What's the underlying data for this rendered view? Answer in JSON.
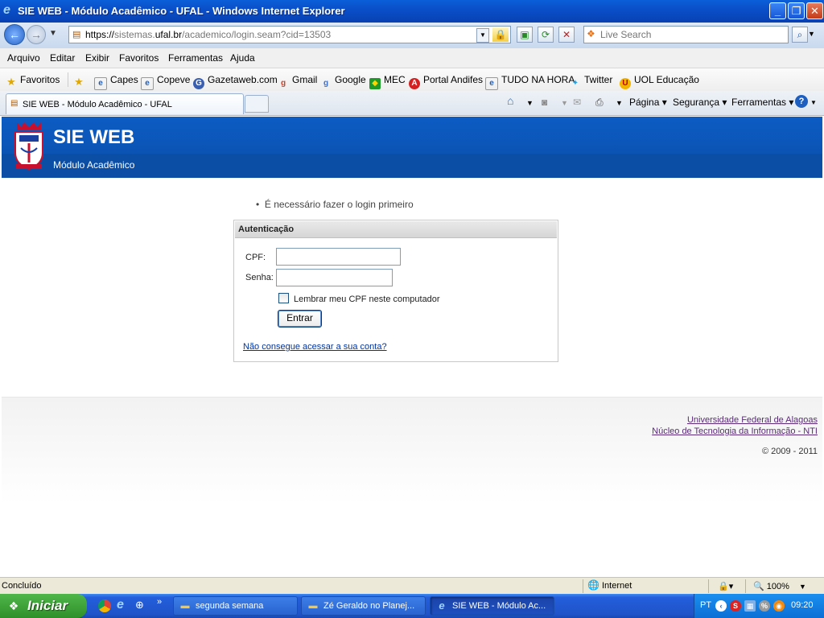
{
  "window": {
    "title": "SIE WEB - Módulo Acadêmico - UFAL - Windows Internet Explorer",
    "icon": "ie-logo-icon"
  },
  "navbar": {
    "url_prefix": "https://",
    "url_pre": "sistemas.",
    "url_domain": "ufal.br",
    "url_rest": "/academico/login.seam?cid=13503",
    "search_placeholder": "Live Search"
  },
  "menu": [
    "Arquivo",
    "Editar",
    "Exibir",
    "Favoritos",
    "Ferramentas",
    "Ajuda"
  ],
  "favorites": {
    "label": "Favoritos",
    "items": [
      "Capes",
      "Copeve",
      "Gazetaweb.com",
      "Gmail",
      "Google",
      "MEC",
      "Portal Andifes",
      "TUDO NA HORA",
      "Twitter",
      "UOL Educação"
    ]
  },
  "tab": {
    "label": "SIE WEB - Módulo Acadêmico - UFAL"
  },
  "commands": {
    "page": "Página",
    "security": "Segurança",
    "tools": "Ferramentas"
  },
  "header": {
    "title": "SIE WEB",
    "subtitle": "Módulo Acadêmico"
  },
  "login": {
    "message": "É necessário fazer o login primeiro",
    "box_title": "Autenticação",
    "cpf_label": "CPF:",
    "cpf_value": "",
    "password_label": "Senha:",
    "password_value": "",
    "remember_label": "Lembrar meu CPF neste computador",
    "remember_checked": false,
    "submit_label": "Entrar",
    "forgot_link": "Não consegue acessar a sua conta?"
  },
  "footer": {
    "link1": "Universidade Federal de Alagoas",
    "link2": "Núcleo de Tecnologia da Informação - NTI",
    "copyright": "© 2009 - 2011"
  },
  "status": {
    "text": "Concluído",
    "zone": "Internet",
    "zoom": "100%"
  },
  "taskbar": {
    "start_label": "Iniciar",
    "tasks": [
      "segunda semana",
      "Zé Geraldo no Planej...",
      "SIE WEB - Módulo Ac..."
    ],
    "lang": "PT",
    "clock": "09:20"
  }
}
